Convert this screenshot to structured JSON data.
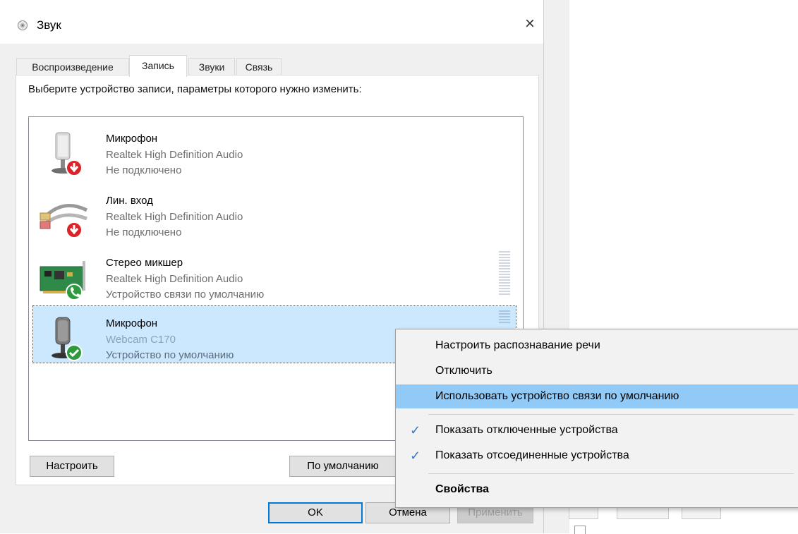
{
  "window": {
    "title": "Звук",
    "close_glyph": "×"
  },
  "tabs": [
    {
      "label": "Воспроизведение"
    },
    {
      "label": "Запись"
    },
    {
      "label": "Звуки"
    },
    {
      "label": "Связь"
    }
  ],
  "instruction": "Выберите устройство записи, параметры которого нужно изменить:",
  "devices": [
    {
      "name": "Микрофон",
      "driver": "Realtek High Definition Audio",
      "status": "Не подключено",
      "icon": "microphone-icon",
      "badge": "disconnected-badge-icon"
    },
    {
      "name": "Лин. вход",
      "driver": "Realtek High Definition Audio",
      "status": "Не подключено",
      "icon": "line-in-cable-icon",
      "badge": "disconnected-badge-icon"
    },
    {
      "name": "Стерео микшер",
      "driver": "Realtek High Definition Audio",
      "status": "Устройство связи по умолчанию",
      "icon": "sound-card-icon",
      "badge": "default-communication-badge-icon"
    },
    {
      "name": "Микрофон",
      "driver": "Webcam C170",
      "status": "Устройство по умолчанию",
      "icon": "microphone-icon",
      "badge": "default-check-badge-icon"
    }
  ],
  "buttons": {
    "configure": "Настроить",
    "set_default": "По умолчанию",
    "ok": "OK",
    "cancel": "Отмена",
    "apply": "Применить"
  },
  "context_menu": [
    {
      "label": "Настроить распознавание речи",
      "checked": false,
      "highlighted": false
    },
    {
      "label": "Отключить",
      "checked": false,
      "highlighted": false
    },
    {
      "label": "Использовать устройство связи по умолчанию",
      "checked": false,
      "highlighted": true
    },
    {
      "label": "Показать отключенные устройства",
      "checked": true,
      "highlighted": false
    },
    {
      "label": "Показать отсоединенные устройства",
      "checked": true,
      "highlighted": false
    },
    {
      "label": "Свойства",
      "checked": false,
      "highlighted": false,
      "bold": true
    }
  ],
  "colors": {
    "selection": "#cce8ff",
    "menu_highlight": "#91c9f7",
    "check": "#3b79c9",
    "disconnected": "#d9252a",
    "connected": "#2e9a3e"
  }
}
